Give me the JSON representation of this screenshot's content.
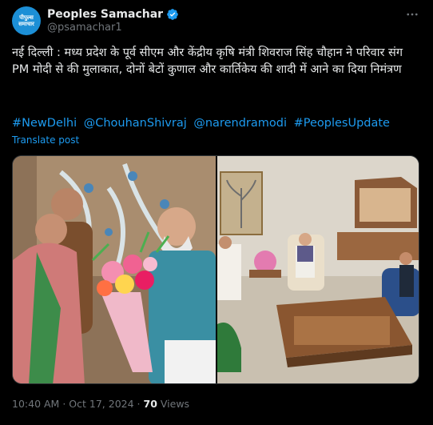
{
  "account": {
    "display_name": "Peoples Samachar",
    "handle": "@psamachar1",
    "avatar_line1": "पीपुल्स",
    "avatar_line2": "समाचार"
  },
  "tweet": {
    "text": "नई दिल्ली : मध्य प्रदेश के पूर्व सीएम और केंद्रीय कृषि मंत्री शिवराज सिंह चौहान ने परिवार संग PM मोदी से की मुलाकात, दोनों बेटों कुणाल और कार्तिकेय की शादी में आने का दिया निमंत्रण",
    "hashtags": [
      "#NewDelhi",
      "@ChouhanShivraj",
      "@narendramodi",
      "#PeoplesUpdate"
    ],
    "translate_label": "Translate post"
  },
  "footer": {
    "time": "10:40 AM",
    "separator": "·",
    "date": "Oct 17, 2024",
    "views_count": "70",
    "views_label": "Views"
  },
  "colors": {
    "background": "#000000",
    "text": "#e7e9ea",
    "muted": "#71767b",
    "link": "#1d9bf0",
    "verified": "#1d9bf0"
  }
}
